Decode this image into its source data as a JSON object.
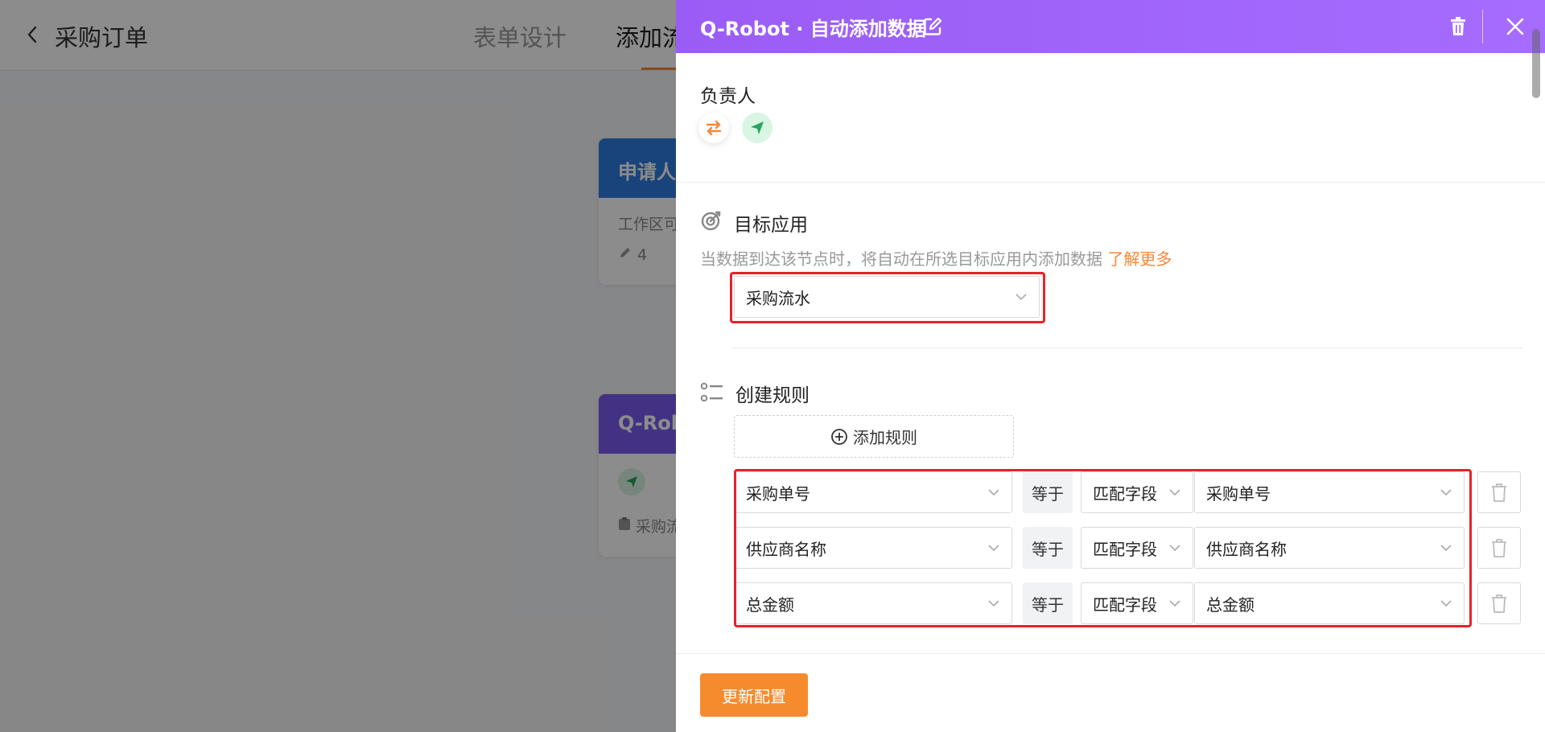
{
  "background": {
    "title": "采购订单",
    "tabs": [
      "表单设计",
      "添加流"
    ],
    "cards": [
      {
        "head": "申请人",
        "body": "工作区可",
        "count": "4"
      },
      {
        "head": "Q-Rob",
        "body": "采购流"
      }
    ]
  },
  "drawer": {
    "title": "Q-Robot · 自动添加数据",
    "owner_label": "负责人",
    "target": {
      "title": "目标应用",
      "desc": "当数据到达该节点时，将自动在所选目标应用内添加数据",
      "learn_more": "了解更多",
      "selected": "采购流水"
    },
    "rules": {
      "title": "创建规则",
      "add_label": "添加规则",
      "items": [
        {
          "field": "采购单号",
          "op": "等于",
          "mode": "匹配字段",
          "value": "采购单号"
        },
        {
          "field": "供应商名称",
          "op": "等于",
          "mode": "匹配字段",
          "value": "供应商名称"
        },
        {
          "field": "总金额",
          "op": "等于",
          "mode": "匹配字段",
          "value": "总金额"
        }
      ]
    },
    "update_label": "更新配置"
  },
  "colors": {
    "accent_orange": "#f68b2e",
    "header_purple": "#9b5cf5",
    "highlight_red": "#e8222a"
  }
}
